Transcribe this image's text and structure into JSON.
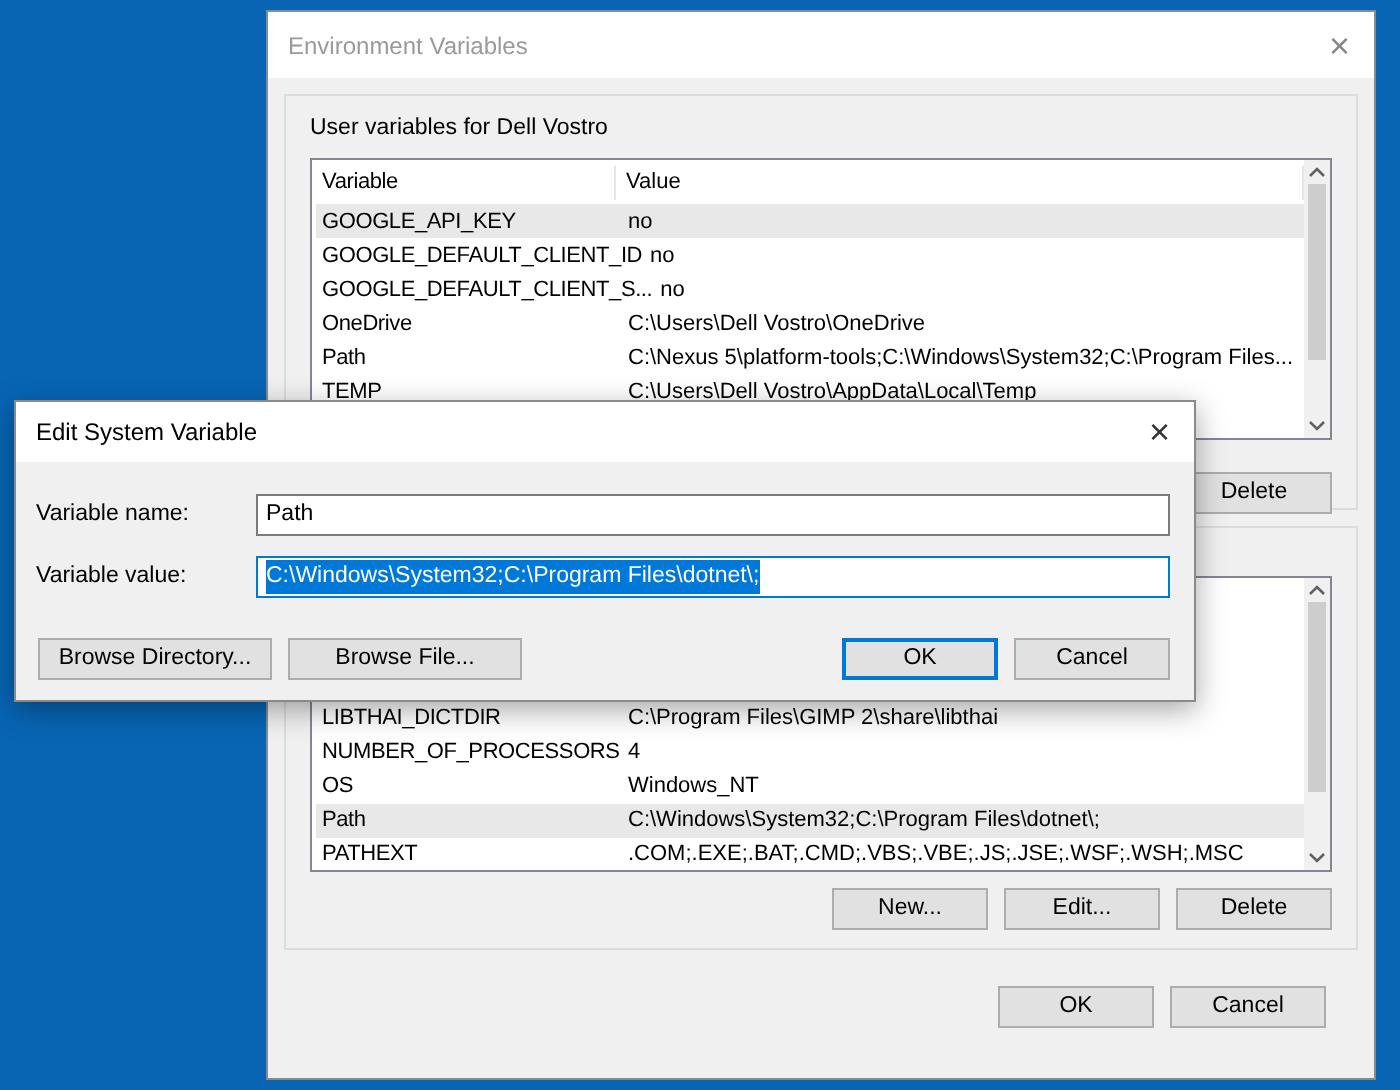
{
  "env_window": {
    "title": "Environment Variables",
    "user_group": {
      "title": "User variables for Dell Vostro",
      "columns": [
        "Variable",
        "Value"
      ],
      "rows": [
        {
          "variable": "GOOGLE_API_KEY",
          "value": "no",
          "selected": true
        },
        {
          "variable": "GOOGLE_DEFAULT_CLIENT_ID",
          "value": "no",
          "selected": false
        },
        {
          "variable": "GOOGLE_DEFAULT_CLIENT_S...",
          "value": "no",
          "selected": false
        },
        {
          "variable": "OneDrive",
          "value": "C:\\Users\\Dell Vostro\\OneDrive",
          "selected": false
        },
        {
          "variable": "Path",
          "value": "C:\\Nexus 5\\platform-tools;C:\\Windows\\System32;C:\\Program Files...",
          "selected": false
        },
        {
          "variable": "TEMP",
          "value": "C:\\Users\\Dell Vostro\\AppData\\Local\\Temp",
          "selected": false
        }
      ],
      "buttons": [
        "Delete"
      ]
    },
    "system_group": {
      "rows": [
        {
          "variable": "LIBTHAI_DICTDIR",
          "value": "C:\\Program Files\\GIMP 2\\share\\libthai",
          "selected": false
        },
        {
          "variable": "NUMBER_OF_PROCESSORS",
          "value": "4",
          "selected": false
        },
        {
          "variable": "OS",
          "value": "Windows_NT",
          "selected": false
        },
        {
          "variable": "Path",
          "value": "C:\\Windows\\System32;C:\\Program Files\\dotnet\\;",
          "selected": true
        },
        {
          "variable": "PATHEXT",
          "value": ".COM;.EXE;.BAT;.CMD;.VBS;.VBE;.JS;.JSE;.WSF;.WSH;.MSC",
          "selected": false
        }
      ],
      "buttons": [
        "New...",
        "Edit...",
        "Delete"
      ]
    },
    "buttons": [
      "OK",
      "Cancel"
    ]
  },
  "edit_dialog": {
    "title": "Edit System Variable",
    "close": "×",
    "fields": [
      {
        "label": "Variable name:",
        "value": "Path",
        "text_selected": false
      },
      {
        "label": "Variable value:",
        "value": "C:\\Windows\\System32;C:\\Program Files\\dotnet\\;",
        "text_selected": true
      }
    ],
    "left_buttons": [
      {
        "label": "Browse Directory...",
        "default": false
      },
      {
        "label": "Browse File...",
        "default": false
      }
    ],
    "right_buttons": [
      {
        "label": "OK",
        "default": true
      },
      {
        "label": "Cancel",
        "default": false
      }
    ]
  }
}
